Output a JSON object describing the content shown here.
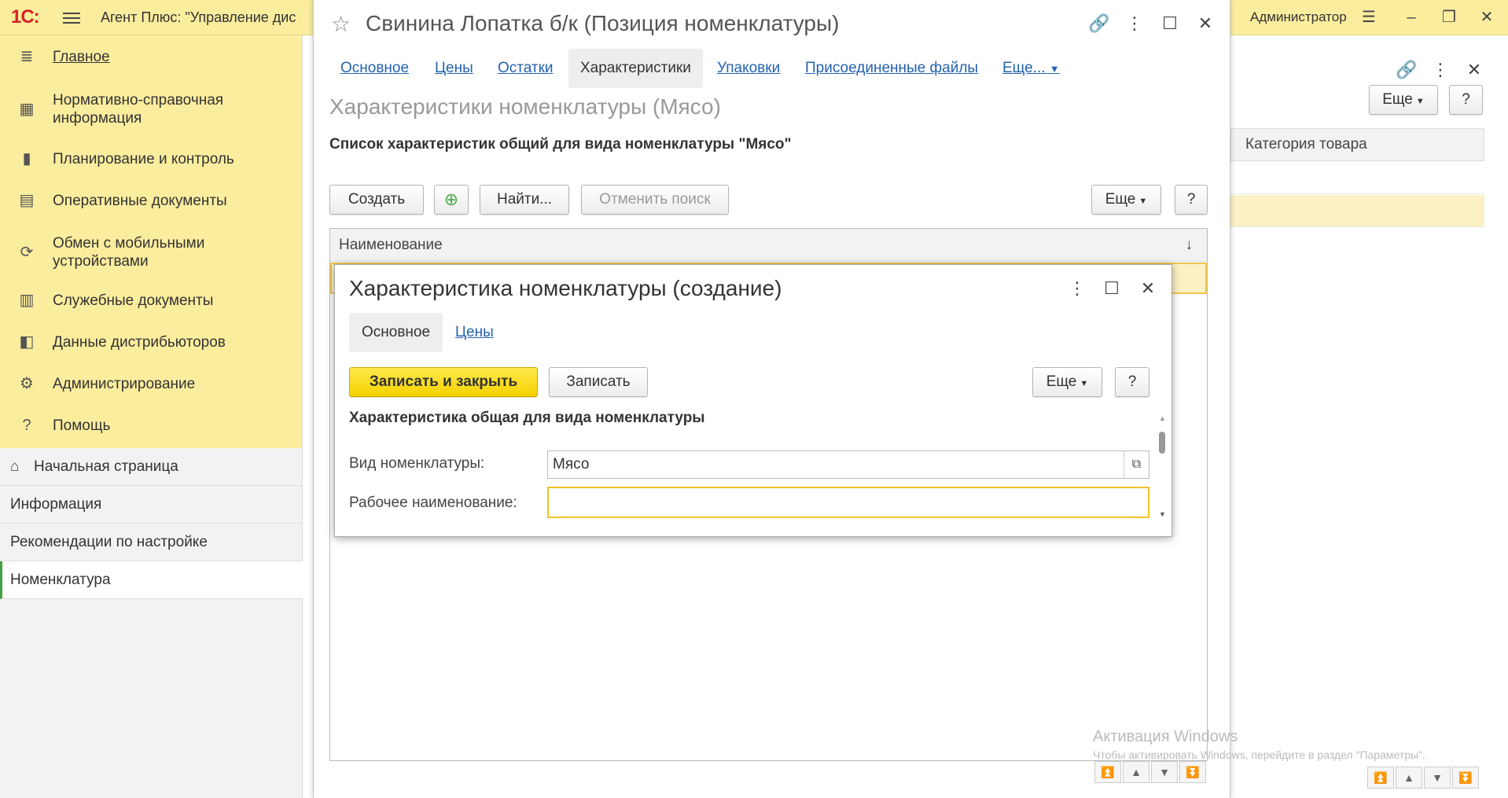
{
  "topbar": {
    "logo": "1С:",
    "app_title": "Агент Плюс: \"Управление дис",
    "user": "Администратор"
  },
  "sidebar": {
    "items": [
      {
        "label": "Главное",
        "icon": "menu-icon"
      },
      {
        "label": "Нормативно-справочная информация",
        "icon": "table-icon"
      },
      {
        "label": "Планирование и контроль",
        "icon": "chart-icon"
      },
      {
        "label": "Оперативные документы",
        "icon": "documents-icon"
      },
      {
        "label": "Обмен с мобильными устройствами",
        "icon": "sync-icon"
      },
      {
        "label": "Служебные документы",
        "icon": "service-docs-icon"
      },
      {
        "label": "Данные дистрибьюторов",
        "icon": "distributor-icon"
      },
      {
        "label": "Администрирование",
        "icon": "gear-icon"
      },
      {
        "label": "Помощь",
        "icon": "help-icon"
      }
    ]
  },
  "navpanel": {
    "items": [
      {
        "label": "Начальная страница"
      },
      {
        "label": "Информация"
      },
      {
        "label": "Рекомендации по настройке"
      },
      {
        "label": "Номенклатура"
      }
    ]
  },
  "bg_list": {
    "more_label": "Еще",
    "help_label": "?",
    "column": "Категория товара"
  },
  "mainwin": {
    "title": "Свинина Лопатка б/к (Позиция номенклатуры)",
    "tabs": [
      "Основное",
      "Цены",
      "Остатки",
      "Характеристики",
      "Упаковки",
      "Присоединенные файлы",
      "Еще..."
    ],
    "subtitle": "Характеристики номенклатуры (Мясо)",
    "list_heading": "Список характеристик общий для вида номенклатуры \"Мясо\"",
    "buttons": {
      "create": "Создать",
      "find": "Найти...",
      "cancel_search": "Отменить поиск",
      "more": "Еще",
      "help": "?"
    },
    "grid": {
      "column": "Наименование",
      "sort": "↓"
    }
  },
  "modal": {
    "title": "Характеристика номенклатуры (создание)",
    "tabs": [
      "Основное",
      "Цены"
    ],
    "buttons": {
      "save_close": "Записать и закрыть",
      "save": "Записать",
      "more": "Еще",
      "help": "?"
    },
    "section": "Характеристика общая для вида номенклатуры",
    "fields": {
      "kind_label": "Вид номенклатуры:",
      "kind_value": "Мясо",
      "name_label": "Рабочее наименование:",
      "name_value": ""
    }
  },
  "watermark": {
    "line1": "Активация Windows",
    "line2": "Чтобы активировать Windows, перейдите в раздел \"Параметры\"."
  }
}
